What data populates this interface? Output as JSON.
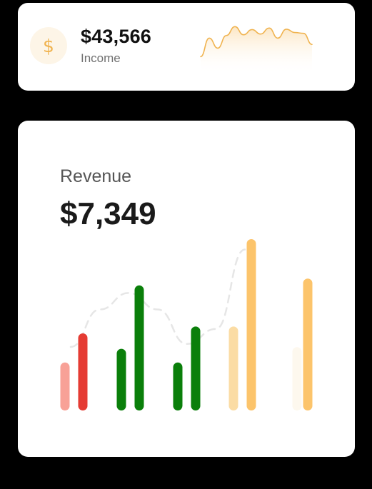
{
  "income": {
    "icon": "dollar-icon",
    "icon_glyph": "$",
    "value": "$43,566",
    "label": "Income",
    "accent": "#f0b34f",
    "sparkline": [
      0.05,
      0.55,
      0.28,
      0.62,
      0.86,
      0.64,
      0.78,
      0.66,
      0.82,
      0.55,
      0.79,
      0.7,
      0.68,
      0.38
    ]
  },
  "revenue": {
    "label": "Revenue",
    "value": "$7,349",
    "trend": [
      0.3,
      0.55,
      0.66,
      0.55,
      0.32,
      0.42,
      0.95
    ],
    "bars": [
      {
        "name": "bar-1a",
        "level": 0.28,
        "color": "#f8a197"
      },
      {
        "name": "bar-1b",
        "level": 0.45,
        "color": "#e53b33"
      },
      {
        "name": "bar-2a",
        "level": 0.36,
        "color": "#0a7f0a"
      },
      {
        "name": "bar-2b",
        "level": 0.73,
        "color": "#0a7f0a"
      },
      {
        "name": "bar-3a",
        "level": 0.28,
        "color": "#0a7f0a"
      },
      {
        "name": "bar-3b",
        "level": 0.49,
        "color": "#0a7f0a"
      },
      {
        "name": "bar-4a",
        "level": 0.49,
        "color": "#fbdca4"
      },
      {
        "name": "bar-4b",
        "level": 1.0,
        "color": "#fcc46b"
      },
      {
        "name": "bar-5a",
        "level": 0.37,
        "color": "#fdf8ee"
      },
      {
        "name": "bar-5b",
        "level": 0.77,
        "color": "#fcc46b"
      }
    ]
  }
}
